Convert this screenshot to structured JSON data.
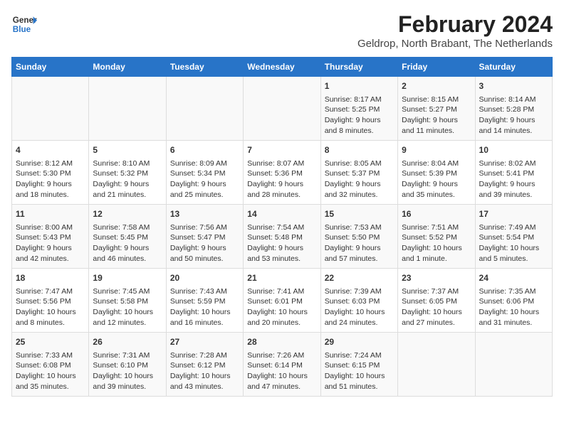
{
  "header": {
    "logo_line1": "General",
    "logo_line2": "Blue",
    "title": "February 2024",
    "subtitle": "Geldrop, North Brabant, The Netherlands"
  },
  "weekdays": [
    "Sunday",
    "Monday",
    "Tuesday",
    "Wednesday",
    "Thursday",
    "Friday",
    "Saturday"
  ],
  "weeks": [
    [
      {
        "day": "",
        "info": ""
      },
      {
        "day": "",
        "info": ""
      },
      {
        "day": "",
        "info": ""
      },
      {
        "day": "",
        "info": ""
      },
      {
        "day": "1",
        "info": "Sunrise: 8:17 AM\nSunset: 5:25 PM\nDaylight: 9 hours\nand 8 minutes."
      },
      {
        "day": "2",
        "info": "Sunrise: 8:15 AM\nSunset: 5:27 PM\nDaylight: 9 hours\nand 11 minutes."
      },
      {
        "day": "3",
        "info": "Sunrise: 8:14 AM\nSunset: 5:28 PM\nDaylight: 9 hours\nand 14 minutes."
      }
    ],
    [
      {
        "day": "4",
        "info": "Sunrise: 8:12 AM\nSunset: 5:30 PM\nDaylight: 9 hours\nand 18 minutes."
      },
      {
        "day": "5",
        "info": "Sunrise: 8:10 AM\nSunset: 5:32 PM\nDaylight: 9 hours\nand 21 minutes."
      },
      {
        "day": "6",
        "info": "Sunrise: 8:09 AM\nSunset: 5:34 PM\nDaylight: 9 hours\nand 25 minutes."
      },
      {
        "day": "7",
        "info": "Sunrise: 8:07 AM\nSunset: 5:36 PM\nDaylight: 9 hours\nand 28 minutes."
      },
      {
        "day": "8",
        "info": "Sunrise: 8:05 AM\nSunset: 5:37 PM\nDaylight: 9 hours\nand 32 minutes."
      },
      {
        "day": "9",
        "info": "Sunrise: 8:04 AM\nSunset: 5:39 PM\nDaylight: 9 hours\nand 35 minutes."
      },
      {
        "day": "10",
        "info": "Sunrise: 8:02 AM\nSunset: 5:41 PM\nDaylight: 9 hours\nand 39 minutes."
      }
    ],
    [
      {
        "day": "11",
        "info": "Sunrise: 8:00 AM\nSunset: 5:43 PM\nDaylight: 9 hours\nand 42 minutes."
      },
      {
        "day": "12",
        "info": "Sunrise: 7:58 AM\nSunset: 5:45 PM\nDaylight: 9 hours\nand 46 minutes."
      },
      {
        "day": "13",
        "info": "Sunrise: 7:56 AM\nSunset: 5:47 PM\nDaylight: 9 hours\nand 50 minutes."
      },
      {
        "day": "14",
        "info": "Sunrise: 7:54 AM\nSunset: 5:48 PM\nDaylight: 9 hours\nand 53 minutes."
      },
      {
        "day": "15",
        "info": "Sunrise: 7:53 AM\nSunset: 5:50 PM\nDaylight: 9 hours\nand 57 minutes."
      },
      {
        "day": "16",
        "info": "Sunrise: 7:51 AM\nSunset: 5:52 PM\nDaylight: 10 hours\nand 1 minute."
      },
      {
        "day": "17",
        "info": "Sunrise: 7:49 AM\nSunset: 5:54 PM\nDaylight: 10 hours\nand 5 minutes."
      }
    ],
    [
      {
        "day": "18",
        "info": "Sunrise: 7:47 AM\nSunset: 5:56 PM\nDaylight: 10 hours\nand 8 minutes."
      },
      {
        "day": "19",
        "info": "Sunrise: 7:45 AM\nSunset: 5:58 PM\nDaylight: 10 hours\nand 12 minutes."
      },
      {
        "day": "20",
        "info": "Sunrise: 7:43 AM\nSunset: 5:59 PM\nDaylight: 10 hours\nand 16 minutes."
      },
      {
        "day": "21",
        "info": "Sunrise: 7:41 AM\nSunset: 6:01 PM\nDaylight: 10 hours\nand 20 minutes."
      },
      {
        "day": "22",
        "info": "Sunrise: 7:39 AM\nSunset: 6:03 PM\nDaylight: 10 hours\nand 24 minutes."
      },
      {
        "day": "23",
        "info": "Sunrise: 7:37 AM\nSunset: 6:05 PM\nDaylight: 10 hours\nand 27 minutes."
      },
      {
        "day": "24",
        "info": "Sunrise: 7:35 AM\nSunset: 6:06 PM\nDaylight: 10 hours\nand 31 minutes."
      }
    ],
    [
      {
        "day": "25",
        "info": "Sunrise: 7:33 AM\nSunset: 6:08 PM\nDaylight: 10 hours\nand 35 minutes."
      },
      {
        "day": "26",
        "info": "Sunrise: 7:31 AM\nSunset: 6:10 PM\nDaylight: 10 hours\nand 39 minutes."
      },
      {
        "day": "27",
        "info": "Sunrise: 7:28 AM\nSunset: 6:12 PM\nDaylight: 10 hours\nand 43 minutes."
      },
      {
        "day": "28",
        "info": "Sunrise: 7:26 AM\nSunset: 6:14 PM\nDaylight: 10 hours\nand 47 minutes."
      },
      {
        "day": "29",
        "info": "Sunrise: 7:24 AM\nSunset: 6:15 PM\nDaylight: 10 hours\nand 51 minutes."
      },
      {
        "day": "",
        "info": ""
      },
      {
        "day": "",
        "info": ""
      }
    ]
  ]
}
